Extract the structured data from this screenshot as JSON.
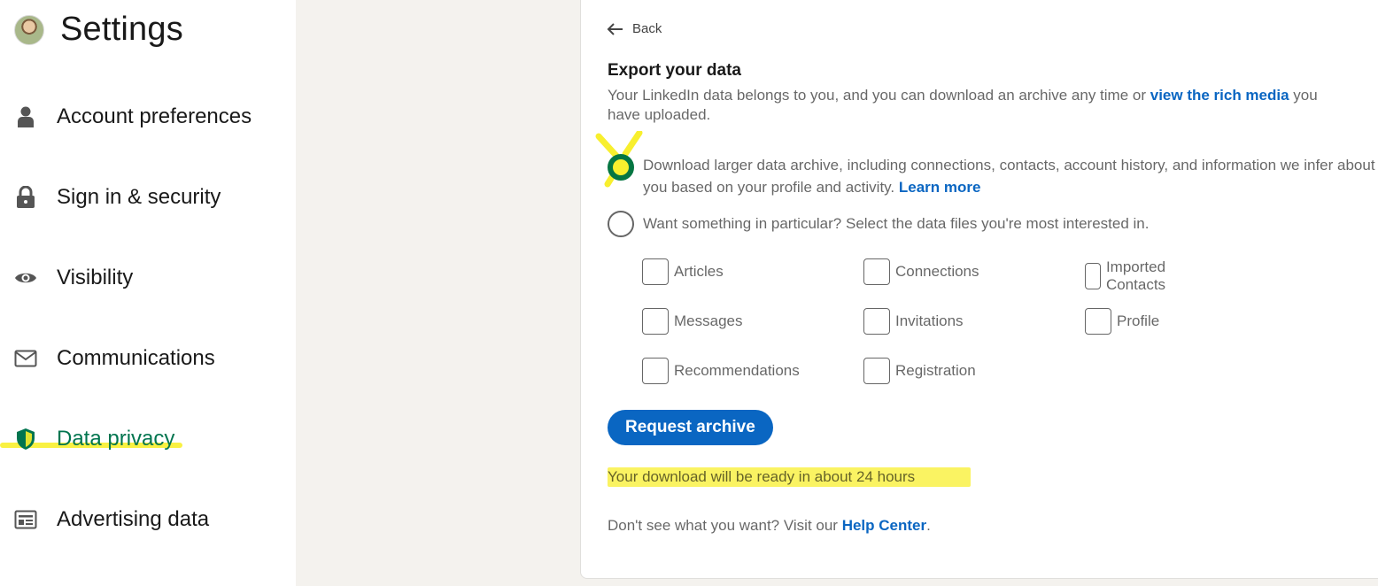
{
  "sidebar": {
    "title": "Settings",
    "items": [
      {
        "label": "Account preferences",
        "icon": "person-icon"
      },
      {
        "label": "Sign in & security",
        "icon": "lock-icon"
      },
      {
        "label": "Visibility",
        "icon": "eye-icon"
      },
      {
        "label": "Communications",
        "icon": "envelope-icon"
      },
      {
        "label": "Data privacy",
        "icon": "shield-icon",
        "active": true
      },
      {
        "label": "Advertising data",
        "icon": "ad-icon"
      }
    ]
  },
  "main": {
    "back_label": "Back",
    "title": "Export your data",
    "description_pre": "Your LinkedIn data belongs to you, and you can download an archive any time or ",
    "description_link": "view the rich media",
    "description_post": " you have uploaded.",
    "option1_text": "Download larger data archive, including connections, contacts, account history, and information we infer about you based on your profile and activity. ",
    "option1_link": "Learn more",
    "option2_text": "Want something in particular? Select the data files you're most interested in.",
    "checkboxes": [
      "Articles",
      "Connections",
      "Imported Contacts",
      "Messages",
      "Invitations",
      "Profile",
      "Recommendations",
      "Registration"
    ],
    "request_button": "Request archive",
    "ready_note": "Your download will be ready in about 24 hours",
    "help_pre": "Don't see what you want? Visit our ",
    "help_link": "Help Center",
    "help_post": "."
  },
  "colors": {
    "accent": "#0a66c2",
    "active_green": "#01754f",
    "highlight": "#f8ef2e"
  }
}
